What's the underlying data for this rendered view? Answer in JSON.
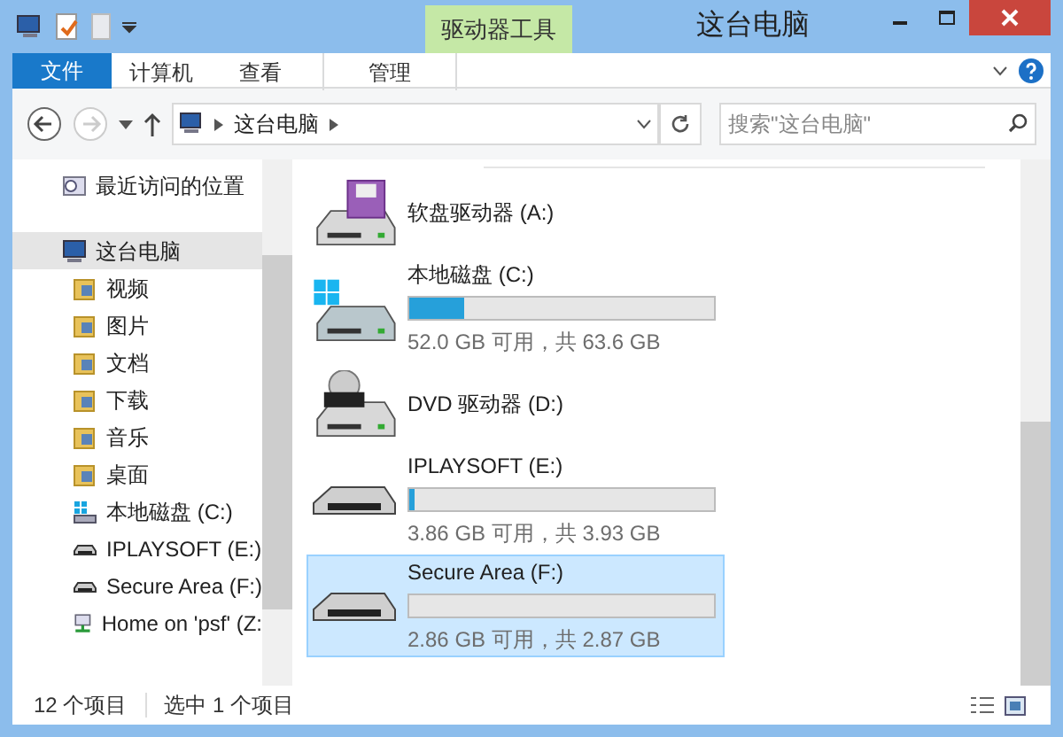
{
  "window": {
    "title": "这台电脑",
    "context_tab": "驱动器工具"
  },
  "ribbon_tabs": [
    {
      "label": "文件",
      "kind": "file",
      "selected": false
    },
    {
      "label": "计算机",
      "kind": "tab",
      "selected": false
    },
    {
      "label": "查看",
      "kind": "tab",
      "selected": false
    },
    {
      "label": "管理",
      "kind": "context",
      "selected": false
    }
  ],
  "address_bar": {
    "path": "这台电脑"
  },
  "search": {
    "placeholder": "搜索\"这台电脑\""
  },
  "nav": [
    {
      "label": "最近访问的位置",
      "kind": "recent",
      "selected": false
    },
    {
      "label": "这台电脑",
      "kind": "computer",
      "selected": true,
      "children": [
        {
          "label": "视频",
          "kind": "folder",
          "selected": false
        },
        {
          "label": "图片",
          "kind": "folder",
          "selected": false
        },
        {
          "label": "文档",
          "kind": "folder",
          "selected": false
        },
        {
          "label": "下载",
          "kind": "folder",
          "selected": false
        },
        {
          "label": "音乐",
          "kind": "folder",
          "selected": false
        },
        {
          "label": "桌面",
          "kind": "folder",
          "selected": false
        },
        {
          "label": "本地磁盘 (C:)",
          "kind": "system",
          "selected": false
        },
        {
          "label": "IPLAYSOFT (E:)",
          "kind": "removable",
          "selected": false
        },
        {
          "label": "Secure Area (F:)",
          "kind": "removable",
          "selected": false
        },
        {
          "label": "Home on 'psf' (Z:",
          "kind": "network",
          "selected": false
        }
      ]
    }
  ],
  "drives": [
    {
      "name": "软盘驱动器 (A:)",
      "kind": "floppy",
      "selected": false
    },
    {
      "name": "本地磁盘 (C:)",
      "kind": "system",
      "selected": false,
      "level": 0.18,
      "space": "52.0 GB 可用，共 63.6 GB"
    },
    {
      "name": "DVD 驱动器 (D:)",
      "kind": "dvd",
      "selected": false
    },
    {
      "name": "IPLAYSOFT (E:)",
      "kind": "removable",
      "selected": false,
      "level": 0.02,
      "space": "3.86 GB 可用，共 3.93 GB"
    },
    {
      "name": "Secure Area (F:)",
      "kind": "removable",
      "selected": true,
      "level": 0,
      "space": "2.86 GB 可用，共 2.87 GB"
    }
  ],
  "status_bar": {
    "count": "12 个项目",
    "selection": "选中 1 个项目"
  }
}
